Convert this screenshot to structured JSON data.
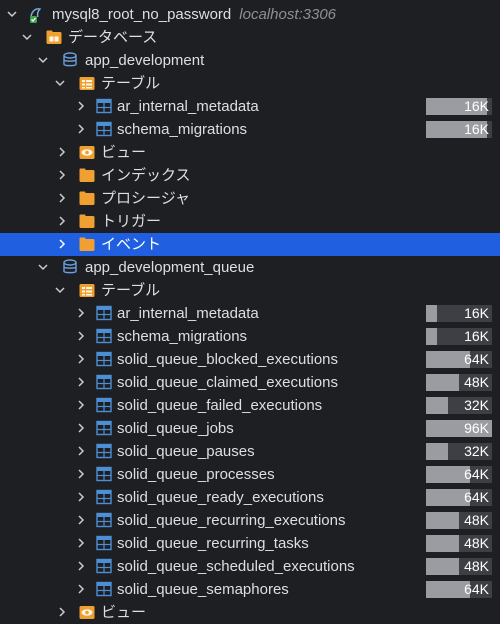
{
  "connection": {
    "name": "mysql8_root_no_password",
    "host": "localhost:3306"
  },
  "databases_label": "データベース",
  "db1": {
    "name": "app_development",
    "tables_label": "テーブル",
    "tables": [
      {
        "name": "ar_internal_metadata",
        "size": "16K",
        "usage": 0.92
      },
      {
        "name": "schema_migrations",
        "size": "16K",
        "usage": 0.92
      }
    ],
    "view_label": "ビュー",
    "index_label": "インデックス",
    "procedure_label": "プロシージャ",
    "trigger_label": "トリガー",
    "event_label": "イベント"
  },
  "db2": {
    "name": "app_development_queue",
    "tables_label": "テーブル",
    "tables": [
      {
        "name": "ar_internal_metadata",
        "size": "16K",
        "usage": 0.17
      },
      {
        "name": "schema_migrations",
        "size": "16K",
        "usage": 0.17
      },
      {
        "name": "solid_queue_blocked_executions",
        "size": "64K",
        "usage": 0.67
      },
      {
        "name": "solid_queue_claimed_executions",
        "size": "48K",
        "usage": 0.5
      },
      {
        "name": "solid_queue_failed_executions",
        "size": "32K",
        "usage": 0.33
      },
      {
        "name": "solid_queue_jobs",
        "size": "96K",
        "usage": 1.0
      },
      {
        "name": "solid_queue_pauses",
        "size": "32K",
        "usage": 0.33
      },
      {
        "name": "solid_queue_processes",
        "size": "64K",
        "usage": 0.67
      },
      {
        "name": "solid_queue_ready_executions",
        "size": "64K",
        "usage": 0.67
      },
      {
        "name": "solid_queue_recurring_executions",
        "size": "48K",
        "usage": 0.5
      },
      {
        "name": "solid_queue_recurring_tasks",
        "size": "48K",
        "usage": 0.5
      },
      {
        "name": "solid_queue_scheduled_executions",
        "size": "48K",
        "usage": 0.5
      },
      {
        "name": "solid_queue_semaphores",
        "size": "64K",
        "usage": 0.67
      }
    ],
    "view_label": "ビュー"
  },
  "colors": {
    "background": "#1e1f22",
    "selection": "#1f5fe0",
    "folder": "#f0a030",
    "database": "#6aa0e0",
    "table": "#4d8fd6",
    "size_fill": "#9a9ca1",
    "size_track": "#3d3f44"
  }
}
